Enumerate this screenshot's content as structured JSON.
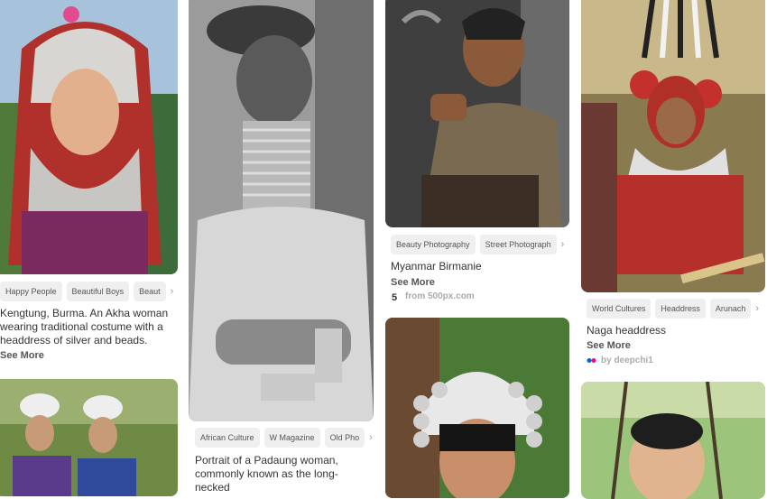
{
  "pins": [
    {
      "tags": [
        "Happy People",
        "Beautiful Boys",
        "Beaut"
      ],
      "description": "Kengtung, Burma. An Akha woman wearing traditional costume with a headdress of silver and beads.",
      "see_more": "See More"
    },
    {
      "tags": [
        "African Culture",
        "W Magazine",
        "Old Pho"
      ],
      "description": "Portrait of a Padaung woman, commonly known as the long-necked"
    },
    {
      "tags": [
        "Beauty Photography",
        "Street Photograph"
      ],
      "title": "Myanmar Birmanie",
      "see_more": "See More",
      "source": "from 500px.com",
      "source_icon": "500px-icon"
    },
    {
      "tags": [
        "World Cultures",
        "Headdress",
        "Arunach"
      ],
      "title": "Naga headdress",
      "see_more": "See More",
      "source": "by deepchi1",
      "source_icon": "flickr-icon"
    }
  ],
  "tag_more_glyph": "›"
}
